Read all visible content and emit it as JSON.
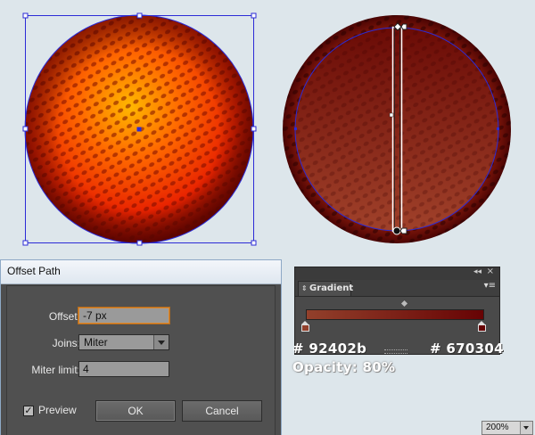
{
  "colors": {
    "gradient_start": "#92402b",
    "gradient_end": "#670304",
    "selection": "#2b2bd6",
    "artboard_bg": "#dde6eb"
  },
  "dialog": {
    "title": "Offset Path",
    "offset_label": "Offset:",
    "offset_value": "-7 px",
    "joins_label": "Joins:",
    "joins_value": "Miter",
    "miter_label": "Miter limit:",
    "miter_value": "4",
    "preview_label": "Preview",
    "preview_checked_glyph": "✓",
    "ok_label": "OK",
    "cancel_label": "Cancel"
  },
  "gradient_panel": {
    "tab_label": "Gradient",
    "tab_arrows_glyph": "⇕",
    "collapse_glyph": "◂◂",
    "close_glyph": "×",
    "menu_glyph": "▾≡"
  },
  "annotations": {
    "start_hex": "# 92402b",
    "end_hex": "# 670304",
    "opacity": "Opacity: 80%"
  },
  "zoom": {
    "value": "200%"
  }
}
